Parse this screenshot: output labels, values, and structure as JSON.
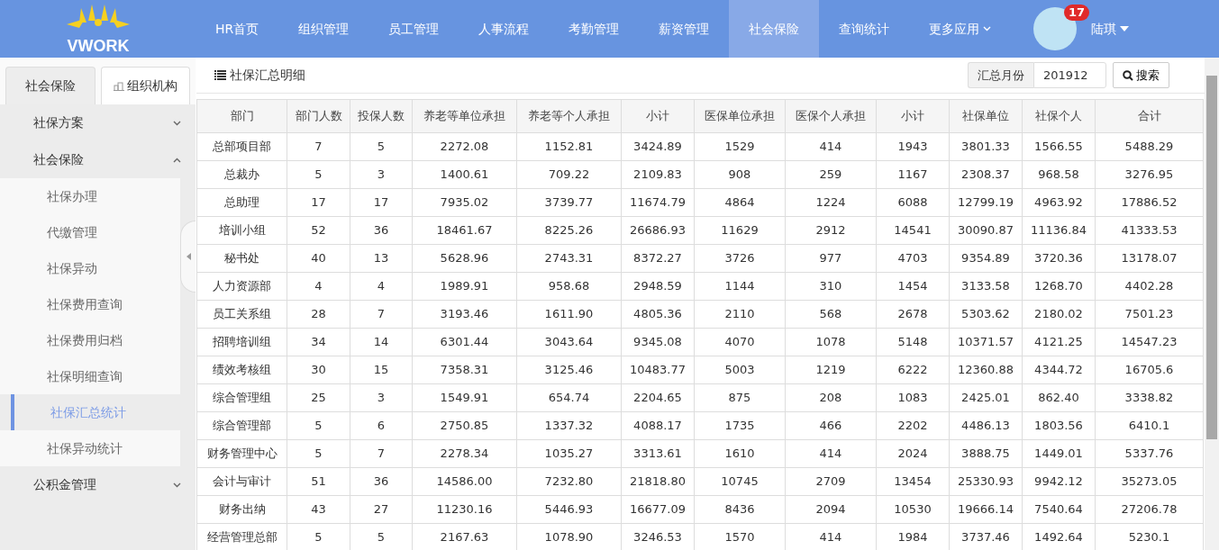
{
  "logo": {
    "text": "VWORK"
  },
  "nav": [
    {
      "label": "HR首页",
      "selected": false,
      "dropdown": false
    },
    {
      "label": "组织管理",
      "selected": false,
      "dropdown": false
    },
    {
      "label": "员工管理",
      "selected": false,
      "dropdown": false
    },
    {
      "label": "人事流程",
      "selected": false,
      "dropdown": false
    },
    {
      "label": "考勤管理",
      "selected": false,
      "dropdown": false
    },
    {
      "label": "薪资管理",
      "selected": false,
      "dropdown": false
    },
    {
      "label": "社会保险",
      "selected": true,
      "dropdown": false
    },
    {
      "label": "查询统计",
      "selected": false,
      "dropdown": false
    },
    {
      "label": "更多应用",
      "selected": false,
      "dropdown": true
    }
  ],
  "user": {
    "name": "陆琪",
    "badge": "17"
  },
  "sidebar_tabs": [
    {
      "label": "社会保险",
      "selected": true,
      "kind": "plain"
    },
    {
      "label": "组织机构",
      "selected": false,
      "kind": "org"
    }
  ],
  "menu": [
    {
      "label": "社保方案",
      "expanded": false
    },
    {
      "label": "社会保险",
      "expanded": true,
      "children": [
        {
          "label": "社保办理",
          "selected": false
        },
        {
          "label": "代缴管理",
          "selected": false
        },
        {
          "label": "社保异动",
          "selected": false
        },
        {
          "label": "社保费用查询",
          "selected": false
        },
        {
          "label": "社保费用归档",
          "selected": false
        },
        {
          "label": "社保明细查询",
          "selected": false
        },
        {
          "label": "社保汇总统计",
          "selected": true
        },
        {
          "label": "社保异动统计",
          "selected": false
        }
      ]
    },
    {
      "label": "公积金管理",
      "expanded": false
    }
  ],
  "toolbar": {
    "title": "社保汇总明细",
    "month_label": "汇总月份",
    "month_value": "201912",
    "search_button": "搜索"
  },
  "table": {
    "columns": [
      "部门",
      "部门人数",
      "投保人数",
      "养老等单位承担",
      "养老等个人承担",
      "小计",
      "医保单位承担",
      "医保个人承担",
      "小计",
      "社保单位",
      "社保个人",
      "合计"
    ],
    "rows": [
      [
        "总部项目部",
        "7",
        "5",
        "2272.08",
        "1152.81",
        "3424.89",
        "1529",
        "414",
        "1943",
        "3801.33",
        "1566.55",
        "5488.29"
      ],
      [
        "总裁办",
        "5",
        "3",
        "1400.61",
        "709.22",
        "2109.83",
        "908",
        "259",
        "1167",
        "2308.37",
        "968.58",
        "3276.95"
      ],
      [
        "总助理",
        "17",
        "17",
        "7935.02",
        "3739.77",
        "11674.79",
        "4864",
        "1224",
        "6088",
        "12799.19",
        "4963.92",
        "17886.52"
      ],
      [
        "培训小组",
        "52",
        "36",
        "18461.67",
        "8225.26",
        "26686.93",
        "11629",
        "2912",
        "14541",
        "30090.87",
        "11136.84",
        "41333.53"
      ],
      [
        "秘书处",
        "40",
        "13",
        "5628.96",
        "2743.31",
        "8372.27",
        "3726",
        "977",
        "4703",
        "9354.89",
        "3720.36",
        "13178.07"
      ],
      [
        "人力资源部",
        "4",
        "4",
        "1989.91",
        "958.68",
        "2948.59",
        "1144",
        "310",
        "1454",
        "3133.58",
        "1268.70",
        "4402.28"
      ],
      [
        "员工关系组",
        "28",
        "7",
        "3193.46",
        "1611.90",
        "4805.36",
        "2110",
        "568",
        "2678",
        "5303.62",
        "2180.02",
        "7501.23"
      ],
      [
        "招聘培训组",
        "34",
        "14",
        "6301.44",
        "3043.64",
        "9345.08",
        "4070",
        "1078",
        "5148",
        "10371.57",
        "4121.25",
        "14547.23"
      ],
      [
        "绩效考核组",
        "30",
        "15",
        "7358.31",
        "3125.46",
        "10483.77",
        "5003",
        "1219",
        "6222",
        "12360.88",
        "4344.72",
        "16705.6"
      ],
      [
        "综合管理组",
        "25",
        "3",
        "1549.91",
        "654.74",
        "2204.65",
        "875",
        "208",
        "1083",
        "2425.01",
        "862.40",
        "3338.82"
      ],
      [
        "综合管理部",
        "5",
        "6",
        "2750.85",
        "1337.32",
        "4088.17",
        "1735",
        "466",
        "2202",
        "4486.13",
        "1803.56",
        "6410.1"
      ],
      [
        "财务管理中心",
        "5",
        "7",
        "2278.34",
        "1035.27",
        "3313.61",
        "1610",
        "414",
        "2024",
        "3888.75",
        "1449.01",
        "5337.76"
      ],
      [
        "会计与审计",
        "51",
        "36",
        "14586.00",
        "7232.80",
        "21818.80",
        "10745",
        "2709",
        "13454",
        "25330.93",
        "9942.12",
        "35273.05"
      ],
      [
        "财务出纳",
        "43",
        "27",
        "11230.16",
        "5446.93",
        "16677.09",
        "8436",
        "2094",
        "10530",
        "19666.14",
        "7540.64",
        "27206.78"
      ],
      [
        "经营管理总部",
        "5",
        "5",
        "2167.63",
        "1078.90",
        "3246.53",
        "1570",
        "414",
        "1984",
        "3737.46",
        "1492.64",
        "5230.1"
      ]
    ]
  }
}
